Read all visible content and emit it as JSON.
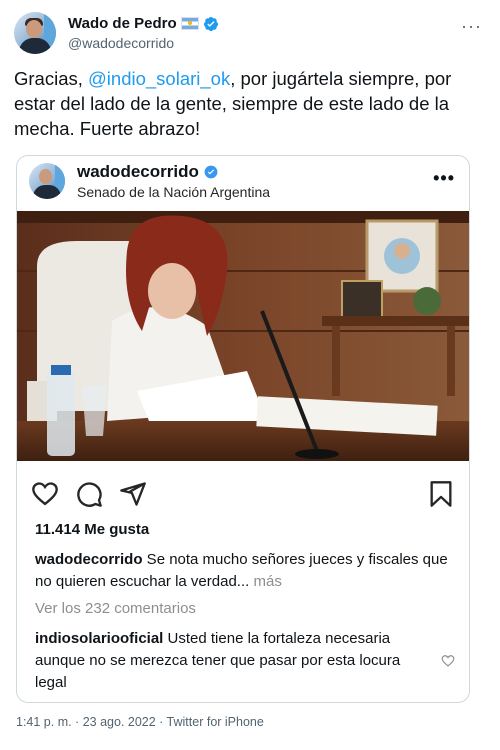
{
  "tweet": {
    "display_name": "Wado de Pedro",
    "username": "@wadodecorrido",
    "text_prefix": "Gracias, ",
    "mention": "@indio_solari_ok",
    "text_suffix": ", por jugártela siempre, por estar del lado de la gente, siempre de este lado de la mecha. Fuerte abrazo!",
    "timestamp": "1:41 p. m. · 23 ago. 2022 · Twitter for iPhone"
  },
  "instagram": {
    "username": "wadodecorrido",
    "location": "Senado de la Nación Argentina",
    "likes": "11.414 Me gusta",
    "caption_user": "wadodecorrido",
    "caption_text": " Se nota mucho señores jueces y fiscales que no quieren escuchar la verdad...",
    "caption_more": " más",
    "view_comments": "Ver los 232 comentarios",
    "comment_user": "indiosolariooficial",
    "comment_text": " Usted tiene la fortaleza necesaria aunque no se merezca tener que pasar por esta locura legal"
  },
  "colors": {
    "accent": "#1d9bf0",
    "text": "#0f1419",
    "muted": "#536471",
    "ig_muted": "#8e8e8e"
  }
}
